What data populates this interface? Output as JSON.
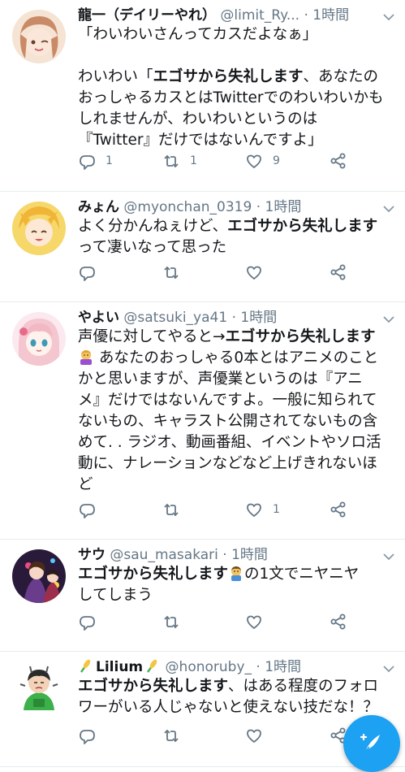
{
  "tweets": [
    {
      "name": "龍一（デイリーやれ）",
      "handle": "@limit_Ry...",
      "sep": "·",
      "time": "1時間",
      "body_lines": [
        [
          {
            "t": "「わいわいさんってカスだよなぁ」",
            "b": false
          }
        ],
        [
          {
            "t": "",
            "b": false
          }
        ],
        [
          {
            "t": "わいわい「",
            "b": false
          },
          {
            "t": "エゴサから失礼します",
            "b": true
          },
          {
            "t": "、あなたの",
            "b": false
          }
        ],
        [
          {
            "t": "おっしゃるカスとはTwitterでのわいわいかも",
            "b": false
          }
        ],
        [
          {
            "t": "しれませんが、わいわいというのは",
            "b": false
          }
        ],
        [
          {
            "t": "『Twitter』だけではないんですよ」",
            "b": false
          }
        ]
      ],
      "reply_count": "1",
      "retweet_count": "1",
      "like_count": "9"
    },
    {
      "name": "みょん",
      "handle": "@myonchan_0319",
      "sep": "·",
      "time": "1時間",
      "body_lines": [
        [
          {
            "t": "よく分かんねぇけど、",
            "b": false
          },
          {
            "t": "エゴサから失礼します",
            "b": true
          }
        ],
        [
          {
            "t": "って凄いなって思った",
            "b": false
          }
        ]
      ],
      "reply_count": "",
      "retweet_count": "",
      "like_count": ""
    },
    {
      "name": "やよい",
      "handle": "@satsuki_ya41",
      "sep": "·",
      "time": "1時間",
      "body_lines": [
        [
          {
            "t": "声優に対してやると→",
            "b": false
          },
          {
            "t": "エゴサから失礼します",
            "b": true
          }
        ],
        [
          {
            "t": "EMOJI",
            "b": false
          },
          {
            "t": " あなたのおっしゃる0本とはアニメのこと",
            "b": false
          }
        ],
        [
          {
            "t": "かと思いますが、声優業というのは『アニ",
            "b": false
          }
        ],
        [
          {
            "t": "メ』だけではないんですよ。一般に知られて",
            "b": false
          }
        ],
        [
          {
            "t": "ないもの、キャラスト公開されてないもの含",
            "b": false
          }
        ],
        [
          {
            "t": "めて. . ラジオ、動画番組、イベントやソロ活",
            "b": false
          }
        ],
        [
          {
            "t": "動に、ナレーションなどなど上げきれないほ",
            "b": false
          }
        ],
        [
          {
            "t": "ど",
            "b": false
          }
        ]
      ],
      "reply_count": "",
      "retweet_count": "",
      "like_count": "1"
    },
    {
      "name": "サウ",
      "handle": "@sau_masakari",
      "sep": "·",
      "time": "1時間",
      "body_lines": [
        [
          {
            "t": "エゴサから失礼します",
            "b": true
          },
          {
            "t": "EMOJI",
            "b": false
          },
          {
            "t": "の1文でニヤニヤ",
            "b": false
          }
        ],
        [
          {
            "t": "してしまう",
            "b": false
          }
        ]
      ],
      "reply_count": "",
      "retweet_count": "",
      "like_count": ""
    },
    {
      "name": "Lilium",
      "handle": "@honoruby_",
      "sep": "·",
      "time": "1時間",
      "body_lines": [
        [
          {
            "t": "エゴサから失礼します",
            "b": true
          },
          {
            "t": "、はある程度のフォロ",
            "b": false
          }
        ],
        [
          {
            "t": "ワーがいる人じゃないと使えない技だな！？",
            "b": false
          }
        ]
      ],
      "reply_count": "",
      "retweet_count": "",
      "like_count": ""
    }
  ],
  "icons": {
    "reply": "reply-icon",
    "retweet": "retweet-icon",
    "like": "heart-icon",
    "share": "share-icon",
    "caret": "chevron-down-icon",
    "compose": "compose-tweet-icon"
  },
  "colors": {
    "accent": "#1da1f2",
    "muted": "#657786",
    "text": "#14171a",
    "divider": "#e6ecf0"
  }
}
